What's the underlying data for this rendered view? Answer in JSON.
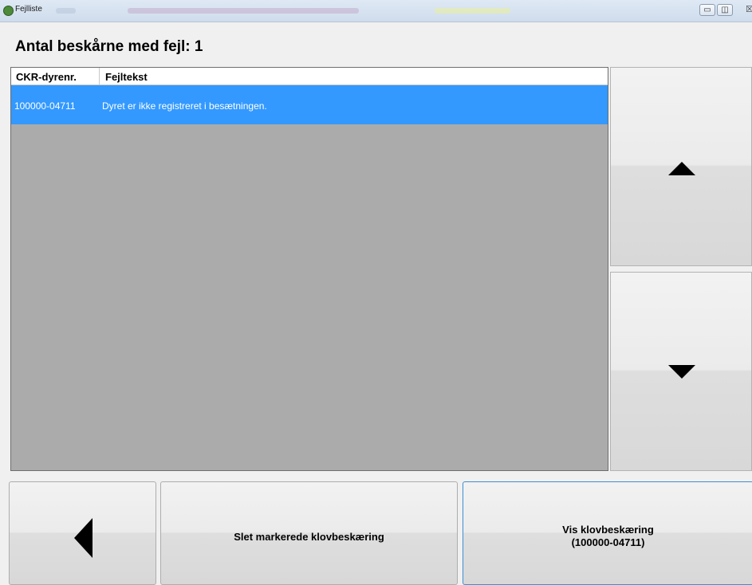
{
  "window": {
    "title": "Fejlliste",
    "buttons": {
      "minimize_icon": "minimize-icon",
      "maximize_icon": "maximize-icon",
      "close_icon": "close-icon",
      "minimize_symbol": "▭",
      "maximize_symbol": "◫",
      "close_symbol": "☒"
    }
  },
  "header": {
    "title": "Antal beskårne med fejl: 1"
  },
  "grid": {
    "columns": [
      "CKR-dyrenr.",
      "Fejltekst"
    ],
    "rows": [
      {
        "ckr": "100000-04711",
        "fejltekst": "Dyret er ikke registreret i besætningen.",
        "selected": true
      }
    ],
    "selected_color": "#3399ff",
    "empty_color": "#ababab"
  },
  "side": {
    "scroll_up_icon": "triangle-up-icon",
    "scroll_down_icon": "triangle-down-icon"
  },
  "footer": {
    "back_icon": "triangle-left-icon",
    "delete_label": "Slet markerede klovbeskæring",
    "view_label_line1": "Vis klovbeskæring",
    "view_label_line2": "(100000-04711)"
  }
}
